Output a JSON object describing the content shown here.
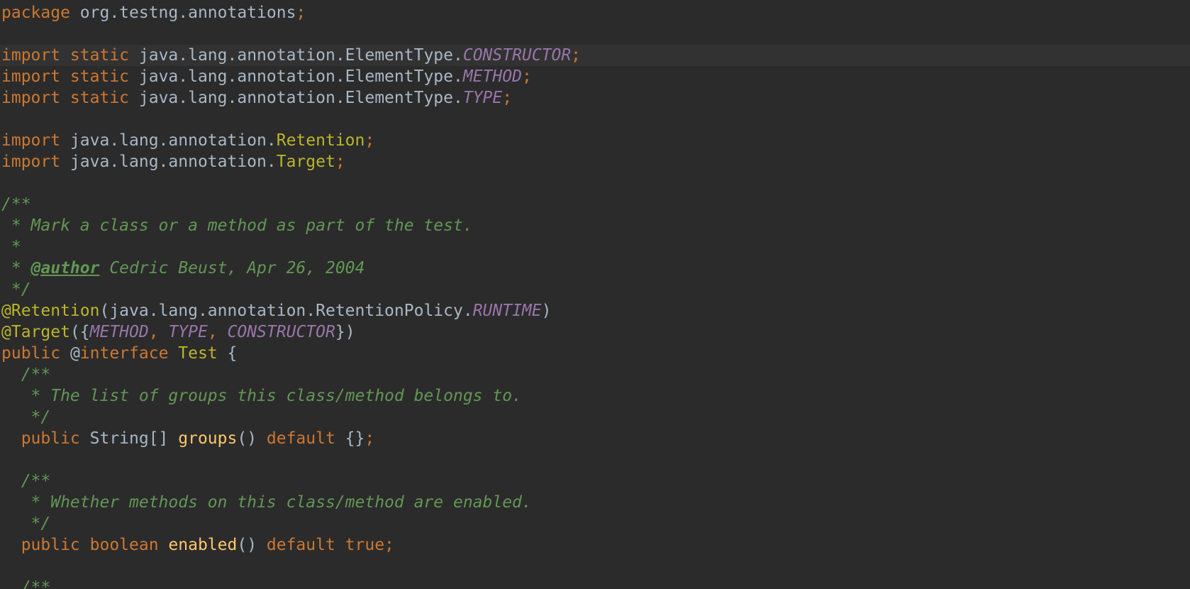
{
  "lines": [
    {
      "current": false,
      "tokens": [
        [
          "kw",
          "package "
        ],
        [
          "pl",
          "org.testng.annotations"
        ],
        [
          "kw",
          ";"
        ]
      ]
    },
    {
      "current": false,
      "tokens": []
    },
    {
      "current": true,
      "tokens": [
        [
          "kw",
          "import static "
        ],
        [
          "pl",
          "java.lang.annotation.ElementType."
        ],
        [
          "cn",
          "CONSTRUCTOR"
        ],
        [
          "kw",
          ";"
        ]
      ]
    },
    {
      "current": false,
      "tokens": [
        [
          "kw",
          "import static "
        ],
        [
          "pl",
          "java.lang.annotation.ElementType."
        ],
        [
          "cn",
          "METHOD"
        ],
        [
          "kw",
          ";"
        ]
      ]
    },
    {
      "current": false,
      "tokens": [
        [
          "kw",
          "import static "
        ],
        [
          "pl",
          "java.lang.annotation.ElementType."
        ],
        [
          "cn",
          "TYPE"
        ],
        [
          "kw",
          ";"
        ]
      ]
    },
    {
      "current": false,
      "tokens": []
    },
    {
      "current": false,
      "tokens": [
        [
          "kw",
          "import "
        ],
        [
          "pl",
          "java.lang.annotation."
        ],
        [
          "cls",
          "Retention"
        ],
        [
          "kw",
          ";"
        ]
      ]
    },
    {
      "current": false,
      "tokens": [
        [
          "kw",
          "import "
        ],
        [
          "pl",
          "java.lang.annotation."
        ],
        [
          "cls",
          "Target"
        ],
        [
          "kw",
          ";"
        ]
      ]
    },
    {
      "current": false,
      "tokens": []
    },
    {
      "current": false,
      "tokens": [
        [
          "doc",
          "/**"
        ]
      ]
    },
    {
      "current": false,
      "tokens": [
        [
          "doc",
          " * Mark a class or a method as part of the test."
        ]
      ]
    },
    {
      "current": false,
      "tokens": [
        [
          "doc",
          " *"
        ]
      ]
    },
    {
      "current": false,
      "tokens": [
        [
          "doc",
          " * "
        ],
        [
          "tag",
          "@author"
        ],
        [
          "doc",
          " Cedric Beust, Apr 26, 2004"
        ]
      ]
    },
    {
      "current": false,
      "tokens": [
        [
          "doc",
          " */"
        ]
      ]
    },
    {
      "current": false,
      "tokens": [
        [
          "cls",
          "@Retention"
        ],
        [
          "pl",
          "(java.lang.annotation.RetentionPolicy."
        ],
        [
          "cn",
          "RUNTIME"
        ],
        [
          "pl",
          ")"
        ]
      ]
    },
    {
      "current": false,
      "tokens": [
        [
          "cls",
          "@Target"
        ],
        [
          "pl",
          "({"
        ],
        [
          "cn",
          "METHOD"
        ],
        [
          "kw",
          ", "
        ],
        [
          "cn",
          "TYPE"
        ],
        [
          "kw",
          ", "
        ],
        [
          "cn",
          "CONSTRUCTOR"
        ],
        [
          "pl",
          "})"
        ]
      ]
    },
    {
      "current": false,
      "tokens": [
        [
          "kw",
          "public "
        ],
        [
          "pl",
          "@"
        ],
        [
          "kw",
          "interface "
        ],
        [
          "cls",
          "Test "
        ],
        [
          "pl",
          "{"
        ]
      ]
    },
    {
      "current": false,
      "tokens": [
        [
          "doc",
          "  /**"
        ]
      ]
    },
    {
      "current": false,
      "tokens": [
        [
          "doc",
          "   * The list of groups this class/method belongs to."
        ]
      ]
    },
    {
      "current": false,
      "tokens": [
        [
          "doc",
          "   */"
        ]
      ]
    },
    {
      "current": false,
      "tokens": [
        [
          "kw",
          "  public "
        ],
        [
          "pl",
          "String[] "
        ],
        [
          "fn",
          "groups"
        ],
        [
          "pl",
          "() "
        ],
        [
          "kw",
          "default "
        ],
        [
          "pl",
          "{}"
        ],
        [
          "kw",
          ";"
        ]
      ]
    },
    {
      "current": false,
      "tokens": []
    },
    {
      "current": false,
      "tokens": [
        [
          "doc",
          "  /**"
        ]
      ]
    },
    {
      "current": false,
      "tokens": [
        [
          "doc",
          "   * Whether methods on this class/method are enabled."
        ]
      ]
    },
    {
      "current": false,
      "tokens": [
        [
          "doc",
          "   */"
        ]
      ]
    },
    {
      "current": false,
      "tokens": [
        [
          "kw",
          "  public boolean "
        ],
        [
          "fn",
          "enabled"
        ],
        [
          "pl",
          "() "
        ],
        [
          "kw",
          "default true;"
        ]
      ]
    },
    {
      "current": false,
      "tokens": []
    },
    {
      "current": false,
      "tokens": [
        [
          "doc",
          "  /**"
        ]
      ]
    }
  ]
}
